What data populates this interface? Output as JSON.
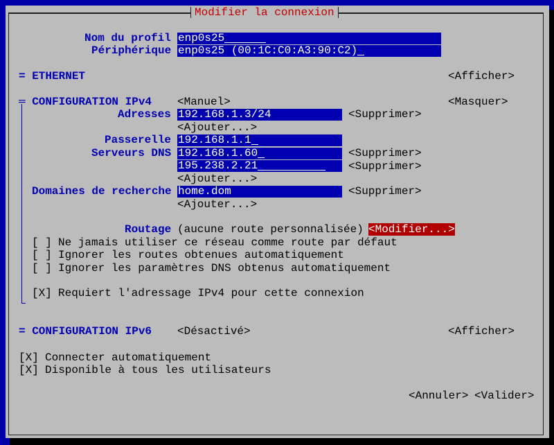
{
  "title": "Modifier la connexion",
  "profile": {
    "name_label": "Nom du profil",
    "name_value": "enp0s25",
    "device_label": "Périphérique",
    "device_value": "enp0s25 (00:1C:C0:A3:90:C2)"
  },
  "ethernet": {
    "label": "= ETHERNET",
    "toggle": "<Afficher>"
  },
  "ipv4": {
    "label": "═ CONFIGURATION IPv4",
    "mode": "<Manuel>",
    "toggle": "<Masquer>",
    "addresses_label": "Adresses",
    "addresses": [
      "192.168.1.3/24"
    ],
    "gateway_label": "Passerelle",
    "gateway": "192.168.1.1",
    "dns_label": "Serveurs DNS",
    "dns": [
      "192.168.1.60",
      "195.238.2.21"
    ],
    "search_label": "Domaines de recherche",
    "search": [
      "home.dom"
    ],
    "remove": "<Supprimer>",
    "add": "<Ajouter...>",
    "routing_label": "Routage",
    "routing_value": "(aucune route personnalisée)",
    "routing_button": "<Modifier...>",
    "options": [
      {
        "checked": "[ ]",
        "label": "Ne jamais utiliser ce réseau comme route par défaut"
      },
      {
        "checked": "[ ]",
        "label": "Ignorer les routes obtenues automatiquement"
      },
      {
        "checked": "[ ]",
        "label": "Ignorer les paramètres DNS obtenus automatiquement"
      },
      {
        "checked": "[X]",
        "label": "Requiert l'adressage IPv4 pour cette connexion"
      }
    ]
  },
  "ipv6": {
    "label": "= CONFIGURATION IPv6",
    "mode": "<Désactivé>",
    "toggle": "<Afficher>"
  },
  "general": [
    {
      "checked": "[X]",
      "label": "Connecter automatiquement"
    },
    {
      "checked": "[X]",
      "label": "Disponible à tous les utilisateurs"
    }
  ],
  "actions": {
    "cancel": "<Annuler>",
    "ok": "<Valider>"
  },
  "colors": {
    "background": "#0000a8",
    "panel": "#bcbcbc",
    "label": "#0000b0",
    "title": "#c00000",
    "highlight": "#b00000"
  }
}
